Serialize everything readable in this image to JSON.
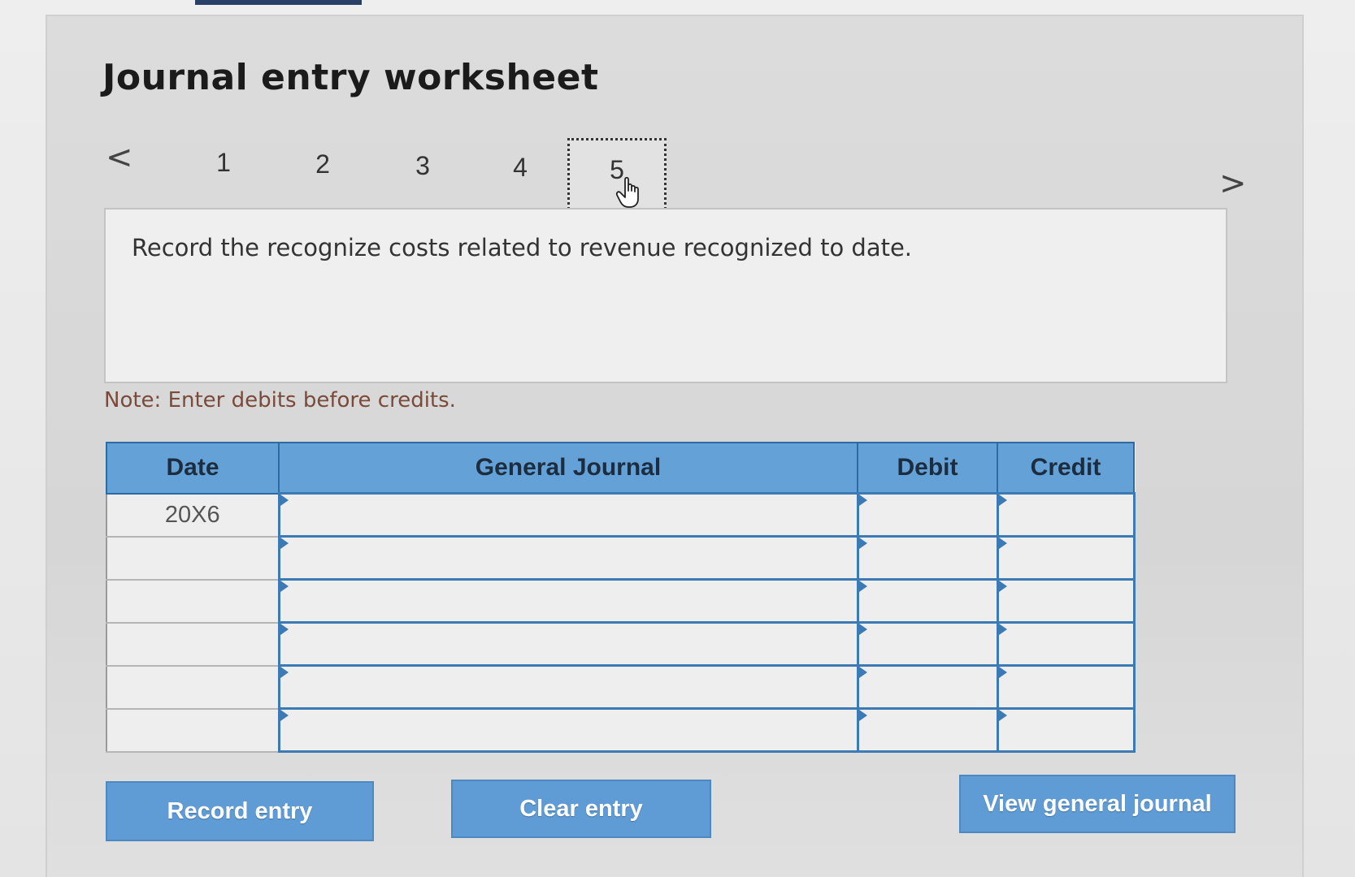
{
  "header": {
    "title": "Journal entry worksheet"
  },
  "nav": {
    "prev_icon": "chevron-left-icon",
    "next_icon": "chevron-right-icon",
    "prev_glyph": "<",
    "next_glyph": ">",
    "steps": [
      "1",
      "2",
      "3",
      "4",
      "5"
    ],
    "active_step": "5"
  },
  "instruction": {
    "text": "Record the recognize costs related to revenue recognized to date."
  },
  "note": "Note: Enter debits before credits.",
  "table": {
    "headers": {
      "date": "Date",
      "general_journal": "General Journal",
      "debit": "Debit",
      "credit": "Credit"
    },
    "rows": [
      {
        "date": "20X6",
        "account": "",
        "debit": "",
        "credit": ""
      },
      {
        "date": "",
        "account": "",
        "debit": "",
        "credit": ""
      },
      {
        "date": "",
        "account": "",
        "debit": "",
        "credit": ""
      },
      {
        "date": "",
        "account": "",
        "debit": "",
        "credit": ""
      },
      {
        "date": "",
        "account": "",
        "debit": "",
        "credit": ""
      },
      {
        "date": "",
        "account": "",
        "debit": "",
        "credit": ""
      }
    ]
  },
  "buttons": {
    "record": "Record entry",
    "clear": "Clear entry",
    "view": "View general journal"
  },
  "colors": {
    "accent": "#5f9bd5",
    "header_blue": "#64a1d6",
    "border_blue": "#3c7ab6",
    "note_text": "#7a4a3a"
  }
}
